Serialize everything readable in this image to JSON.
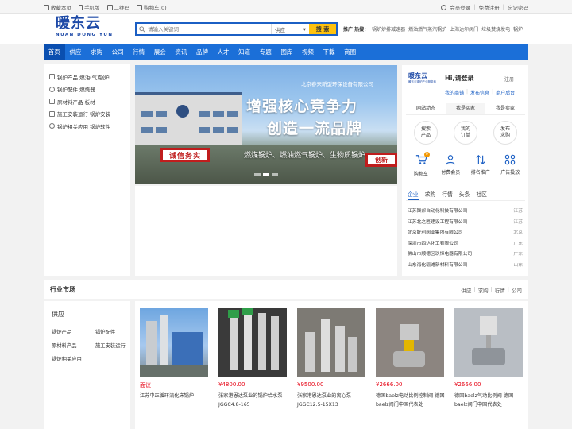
{
  "topbar": {
    "left": [
      {
        "icon": "bookmark-icon",
        "label": "收藏本页"
      },
      {
        "icon": "phone-icon",
        "label": "手机版"
      },
      {
        "icon": "qrcode-icon",
        "label": "二维码"
      },
      {
        "icon": "cart-icon",
        "label": "购物车(0)"
      }
    ],
    "right": {
      "login": "会员登录",
      "register": "免费注册",
      "forgot": "忘记密码",
      "sep": "|"
    }
  },
  "logo": {
    "cn": "暖东云",
    "en": "NUAN DONG YUN"
  },
  "search": {
    "placeholder": "请输入关键词",
    "category": "供应",
    "button": "搜 索"
  },
  "hot": {
    "label": "推广 热搜：",
    "items": [
      "锅炉炉排减速器",
      "燃油燃气蒸汽锅炉",
      "上海达尔阀门",
      "垃圾焚烧发电",
      "锅炉"
    ]
  },
  "nav": [
    "首页",
    "供应",
    "求购",
    "公司",
    "行情",
    "展会",
    "资讯",
    "品牌",
    "人才",
    "知道",
    "专题",
    "图库",
    "视频",
    "下载",
    "商圈"
  ],
  "sidebar": [
    "锅炉产品 燃油(气)锅炉",
    "锅炉配件 燃烧器",
    "原材料产品 板材",
    "施工安装运行 锅炉安装",
    "锅炉相关应用 锅炉软件"
  ],
  "banner": {
    "company": "北京春来新型环保设备有限公司",
    "line1": "增强核心竞争力",
    "line2": "创造一流品牌",
    "sub": "燃煤锅炉、燃油燃气锅炉、生物质锅炉",
    "sign": "诚信务实",
    "sign2": "创新"
  },
  "user_panel": {
    "logo": "暖东云",
    "logo_sub": "暖东云锅炉产业服务商",
    "greeting": "Hi,请登录",
    "register": "注册",
    "links": [
      "我的商铺",
      "|",
      "发布信息",
      "|",
      "商户后台"
    ],
    "tabs": [
      "网站动态",
      "我是买家",
      "我是卖家"
    ],
    "circles": [
      {
        "l1": "搜索",
        "l2": "产品"
      },
      {
        "l1": "我的",
        "l2": "订单"
      },
      {
        "l1": "发布",
        "l2": "求购"
      }
    ],
    "quick": [
      {
        "label": "购物车",
        "badge": "0"
      },
      {
        "label": "付费会员"
      },
      {
        "label": "排名推广"
      },
      {
        "label": "广告投放"
      }
    ]
  },
  "news_tabs": [
    "企业",
    "求购",
    "行情",
    "头条",
    "社区"
  ],
  "companies": [
    {
      "name": "江苏聚邦自动化科技有限公司",
      "loc": "江苏"
    },
    {
      "name": "江苏北之匠建设工程有限公司",
      "loc": "江苏"
    },
    {
      "name": "北京好利阀业集团有限公司",
      "loc": "北京"
    },
    {
      "name": "深圳市四达化工有限公司",
      "loc": "广东"
    },
    {
      "name": "佛山市顺德区玖恒电器有限公司",
      "loc": "广东"
    },
    {
      "name": "山东海化骊滩新材料有限公司",
      "loc": "山东"
    }
  ],
  "market": {
    "title": "行业市场",
    "links": [
      "供应",
      "|",
      "求购",
      "|",
      "行情",
      "|",
      "公司"
    ],
    "left_title": "供应",
    "categories": [
      "锅炉产品",
      "锅炉配件",
      "原材料产品",
      "施工安装运行",
      "锅炉相关应用"
    ]
  },
  "products": [
    {
      "price": "面议",
      "name": "江苏中正循环流化床锅炉"
    },
    {
      "price": "¥4800.00",
      "name": "张家港恩达泵业的锅炉给水泵JGGC4.8-165"
    },
    {
      "price": "¥9500.00",
      "name": "张家港恩达泵业的离心泵JGGC12.5-15X13"
    },
    {
      "price": "¥2666.00",
      "name": "德国baelz电动比例控制阀 德国baelz阀门中国代表处"
    },
    {
      "price": "¥2666.00",
      "name": "德国baelz气动比例阀 德国baelz阀门中国代表处"
    }
  ],
  "colors": {
    "brand_blue": "#1b6fd8",
    "search_yellow": "#ffc20e",
    "price_red": "#e60012"
  }
}
